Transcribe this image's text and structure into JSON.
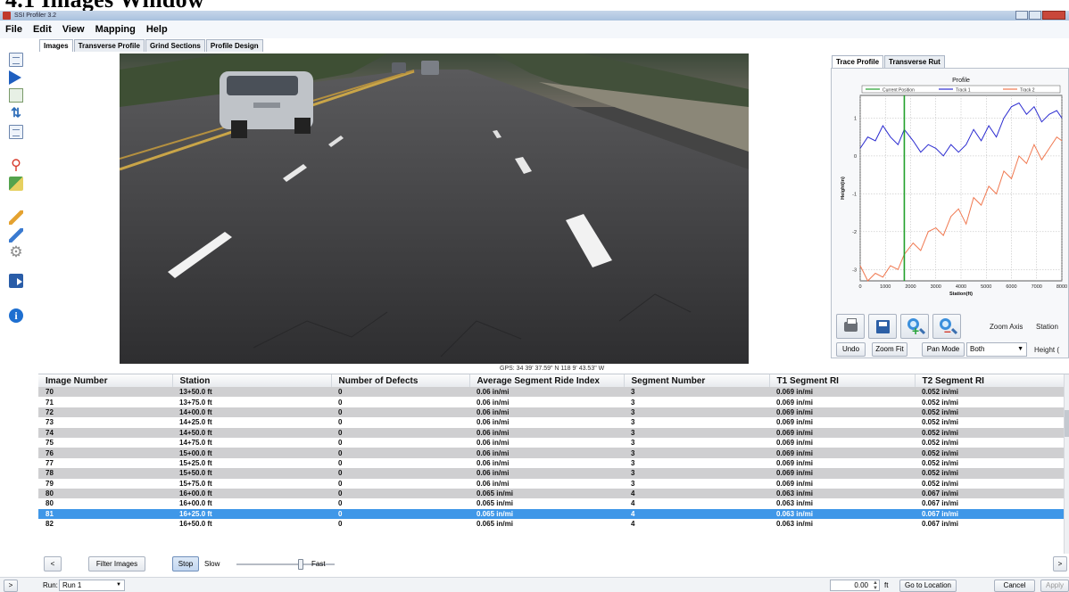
{
  "document": {
    "heading": "4.1    Images Window"
  },
  "window": {
    "title": "SSI Profiler 3.2"
  },
  "menu": [
    "File",
    "Edit",
    "View",
    "Mapping",
    "Help"
  ],
  "tabs": [
    "Images",
    "Transverse Profile",
    "Grind Sections",
    "Profile Design"
  ],
  "left_toolbar_icons": [
    "document-list-icon",
    "play-icon",
    "chart-icon",
    "adjust-icon",
    "document-edit-icon",
    "map-pin-icon",
    "map-icon",
    "pencil-icon",
    "pencil-blue-icon",
    "gear-icon",
    "export-icon",
    "info-icon"
  ],
  "image_caption": "GPS: 34 39' 37.59\" N 118 9' 43.53\" W",
  "side_tabs": [
    "Trace Profile",
    "Transverse Rut"
  ],
  "chart_data": {
    "type": "line",
    "title": "Profile",
    "xlabel": "Station(ft)",
    "ylabel": "Height(in)",
    "xlim": [
      0,
      8000
    ],
    "ylim": [
      -3.3,
      1.6
    ],
    "x_ticks": [
      0,
      1000,
      2000,
      3000,
      4000,
      5000,
      6000,
      7000,
      8000
    ],
    "y_ticks": [
      1,
      0,
      -1,
      -2,
      -3
    ],
    "grid": true,
    "legend": {
      "placement": "top",
      "entries": [
        "Current Position",
        "Track 1",
        "Track 2"
      ]
    },
    "current_position_x": 1750,
    "series": [
      {
        "name": "Track 1",
        "color": "#2b2bd0",
        "x": [
          0,
          300,
          600,
          900,
          1200,
          1500,
          1750,
          2100,
          2400,
          2700,
          3000,
          3300,
          3600,
          3900,
          4200,
          4500,
          4800,
          5100,
          5400,
          5700,
          6000,
          6300,
          6600,
          6900,
          7200,
          7500,
          7800,
          8000
        ],
        "y": [
          0.2,
          0.5,
          0.4,
          0.8,
          0.5,
          0.3,
          0.7,
          0.4,
          0.1,
          0.3,
          0.2,
          0.0,
          0.3,
          0.1,
          0.3,
          0.7,
          0.4,
          0.8,
          0.5,
          1.0,
          1.3,
          1.4,
          1.1,
          1.3,
          0.9,
          1.1,
          1.2,
          1.0
        ]
      },
      {
        "name": "Track 2",
        "color": "#f07850",
        "x": [
          0,
          300,
          600,
          900,
          1200,
          1500,
          1750,
          2100,
          2400,
          2700,
          3000,
          3300,
          3600,
          3900,
          4200,
          4500,
          4800,
          5100,
          5400,
          5700,
          6000,
          6300,
          6600,
          6900,
          7200,
          7500,
          7800,
          8000
        ],
        "y": [
          -2.9,
          -3.3,
          -3.1,
          -3.2,
          -2.9,
          -3.0,
          -2.6,
          -2.3,
          -2.5,
          -2.0,
          -1.9,
          -2.1,
          -1.6,
          -1.4,
          -1.8,
          -1.1,
          -1.3,
          -0.8,
          -1.0,
          -0.4,
          -0.6,
          0.0,
          -0.2,
          0.3,
          -0.1,
          0.2,
          0.5,
          0.4
        ]
      }
    ]
  },
  "chart_toolbar": {
    "icons": [
      "print-icon",
      "save-icon",
      "zoom-in-icon",
      "zoom-out-icon"
    ],
    "zoom_axis_label": "Zoom Axis",
    "station_label": "Station",
    "undo": "Undo",
    "zoom_fit": "Zoom Fit",
    "pan_mode": "Pan Mode",
    "axis_select": "Both",
    "height_label": "Height ("
  },
  "table": {
    "columns": [
      "Image Number",
      "Station",
      "Number of Defects",
      "Average Segment Ride Index",
      "Segment Number",
      "T1 Segment RI",
      "T2 Segment RI"
    ],
    "rows": [
      [
        "70",
        "13+50.0 ft",
        "0",
        "0.06 in/mi",
        "3",
        "0.069 in/mi",
        "0.052 in/mi"
      ],
      [
        "71",
        "13+75.0 ft",
        "0",
        "0.06 in/mi",
        "3",
        "0.069 in/mi",
        "0.052 in/mi"
      ],
      [
        "72",
        "14+00.0 ft",
        "0",
        "0.06 in/mi",
        "3",
        "0.069 in/mi",
        "0.052 in/mi"
      ],
      [
        "73",
        "14+25.0 ft",
        "0",
        "0.06 in/mi",
        "3",
        "0.069 in/mi",
        "0.052 in/mi"
      ],
      [
        "74",
        "14+50.0 ft",
        "0",
        "0.06 in/mi",
        "3",
        "0.069 in/mi",
        "0.052 in/mi"
      ],
      [
        "75",
        "14+75.0 ft",
        "0",
        "0.06 in/mi",
        "3",
        "0.069 in/mi",
        "0.052 in/mi"
      ],
      [
        "76",
        "15+00.0 ft",
        "0",
        "0.06 in/mi",
        "3",
        "0.069 in/mi",
        "0.052 in/mi"
      ],
      [
        "77",
        "15+25.0 ft",
        "0",
        "0.06 in/mi",
        "3",
        "0.069 in/mi",
        "0.052 in/mi"
      ],
      [
        "78",
        "15+50.0 ft",
        "0",
        "0.06 in/mi",
        "3",
        "0.069 in/mi",
        "0.052 in/mi"
      ],
      [
        "79",
        "15+75.0 ft",
        "0",
        "0.06 in/mi",
        "3",
        "0.069 in/mi",
        "0.052 in/mi"
      ],
      [
        "80",
        "16+00.0 ft",
        "0",
        "0.065 in/mi",
        "4",
        "0.063 in/mi",
        "0.067 in/mi"
      ],
      [
        "80",
        "16+00.0 ft",
        "0",
        "0.065 in/mi",
        "4",
        "0.063 in/mi",
        "0.067 in/mi"
      ],
      [
        "81",
        "16+25.0 ft",
        "0",
        "0.065 in/mi",
        "4",
        "0.063 in/mi",
        "0.067 in/mi"
      ],
      [
        "82",
        "16+50.0 ft",
        "0",
        "0.065 in/mi",
        "4",
        "0.063 in/mi",
        "0.067 in/mi"
      ]
    ],
    "selected_row": 12
  },
  "playback": {
    "prev": "<",
    "filter": "Filter Images",
    "stop": "Stop",
    "slow": "Slow",
    "fast": "Fast",
    "next": ">",
    "speed_level": 0.65
  },
  "status": {
    "expand": ">",
    "run_label": "Run:",
    "run_value": "Run 1",
    "location_value": "0.00",
    "unit": "ft",
    "goto": "Go to Location",
    "cancel": "Cancel",
    "apply": "Apply"
  },
  "colors": {
    "selected_row": "#3f97e8",
    "odd_row": "#cfcfd1",
    "current_position": "#22a02a"
  }
}
